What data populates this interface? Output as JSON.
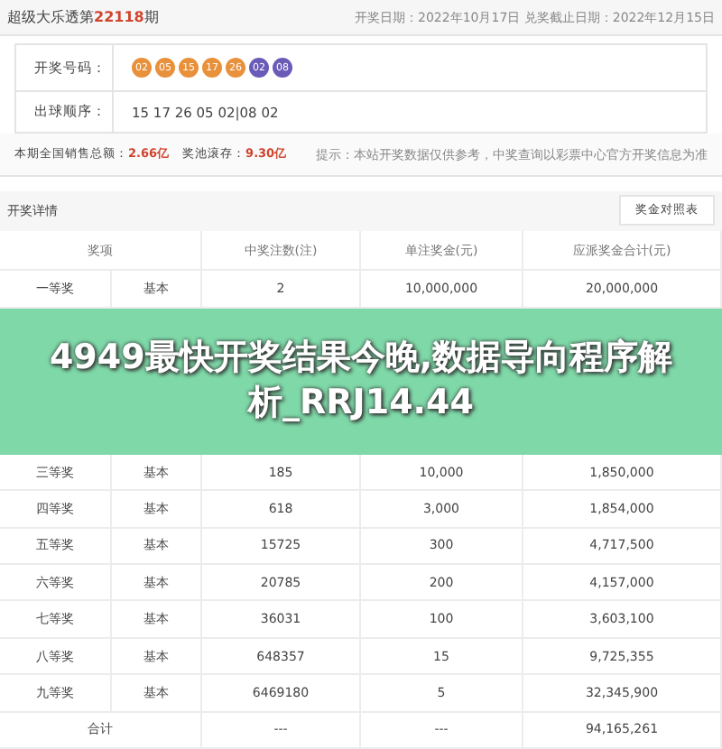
{
  "header": {
    "title": "超级大乐透第",
    "issue": "22118",
    "suffix": "期",
    "dates": "开奖日期：2022年10月17日 兑奖截止日期：2022年12月15日"
  },
  "draw": {
    "numbers_label": "开奖号码：",
    "balls": [
      {
        "text": "02",
        "color": "#e8903a"
      },
      {
        "text": "05",
        "color": "#e8903a"
      },
      {
        "text": "15",
        "color": "#e8903a"
      },
      {
        "text": "17",
        "color": "#e8903a"
      },
      {
        "text": "26",
        "color": "#e8903a"
      },
      {
        "text": "02",
        "color": "#6a5bb8"
      },
      {
        "text": "08",
        "color": "#6a5bb8"
      }
    ],
    "order_label": "出球顺序：",
    "order": "15 17 26 05 02|08 02"
  },
  "summary": {
    "sales_label": "本期全国销售总额：",
    "sales": "2.66亿",
    "pool_label": "奖池滚存：",
    "pool": "9.30亿",
    "hint": "提示：本站开奖数据仅供参考，中奖查询以彩票中心官方开奖信息为准"
  },
  "details": {
    "title": "开奖详情",
    "button": "奖金对照表",
    "columns": [
      "奖项",
      "中奖注数(注)",
      "单注奖金(元)",
      "应派奖金合计(元)"
    ],
    "rows_before": [
      [
        "一等奖",
        "基本",
        "2",
        "10,000,000",
        "20,000,000"
      ]
    ],
    "banner": "4949最快开奖结果今晚,数据导向程序解析_RRJ14.44",
    "rows_after": [
      [
        "三等奖",
        "基本",
        "185",
        "10,000",
        "1,850,000"
      ],
      [
        "四等奖",
        "基本",
        "618",
        "3,000",
        "1,854,000"
      ],
      [
        "五等奖",
        "基本",
        "15725",
        "300",
        "4,717,500"
      ],
      [
        "六等奖",
        "基本",
        "20785",
        "200",
        "4,157,000"
      ],
      [
        "七等奖",
        "基本",
        "36031",
        "100",
        "3,603,100"
      ],
      [
        "八等奖",
        "基本",
        "648357",
        "15",
        "9,725,355"
      ],
      [
        "九等奖",
        "基本",
        "6469180",
        "5",
        "32,345,900"
      ]
    ],
    "total": [
      "合计",
      "---",
      "---",
      "94,165,261"
    ]
  }
}
